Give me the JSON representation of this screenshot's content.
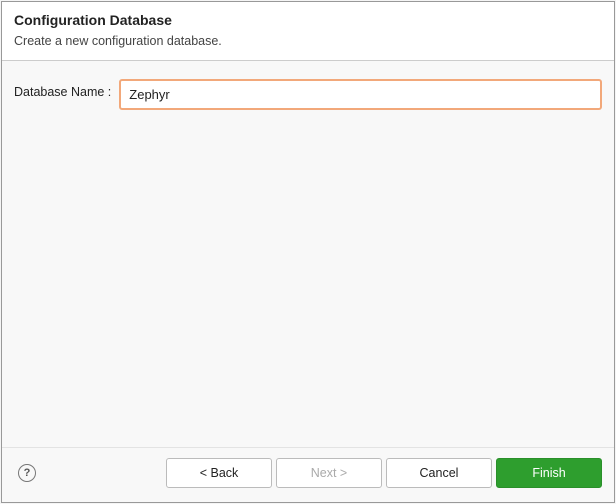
{
  "header": {
    "title": "Configuration Database",
    "subtitle": "Create a new configuration database."
  },
  "form": {
    "dbname_label": "Database Name :",
    "dbname_value": "Zephyr"
  },
  "footer": {
    "help_symbol": "?",
    "back_label": "< Back",
    "next_label": "Next >",
    "cancel_label": "Cancel",
    "finish_label": "Finish"
  }
}
